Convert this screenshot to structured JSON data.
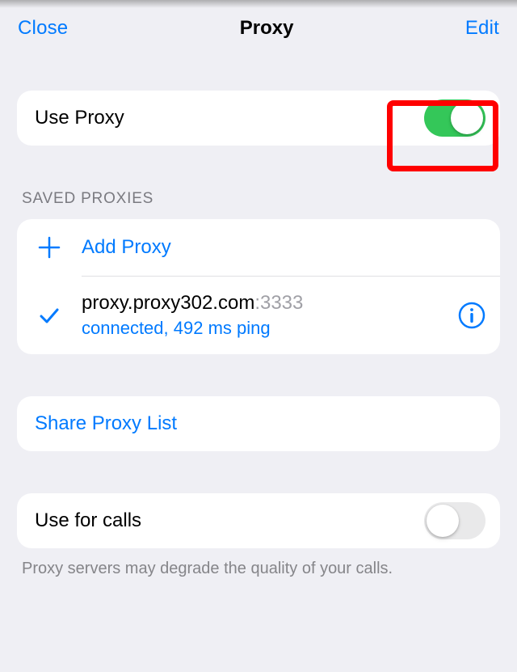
{
  "nav": {
    "close": "Close",
    "title": "Proxy",
    "edit": "Edit"
  },
  "useProxy": {
    "label": "Use Proxy",
    "enabled": true
  },
  "savedProxies": {
    "header": "SAVED PROXIES",
    "add": "Add Proxy",
    "items": [
      {
        "host": "proxy.proxy302.com",
        "portSep": ":",
        "port": "3333",
        "status": "connected, 492 ms ping",
        "selected": true
      }
    ]
  },
  "share": {
    "label": "Share Proxy List"
  },
  "calls": {
    "label": "Use for calls",
    "enabled": false,
    "footer": "Proxy servers may degrade the quality of your calls."
  }
}
